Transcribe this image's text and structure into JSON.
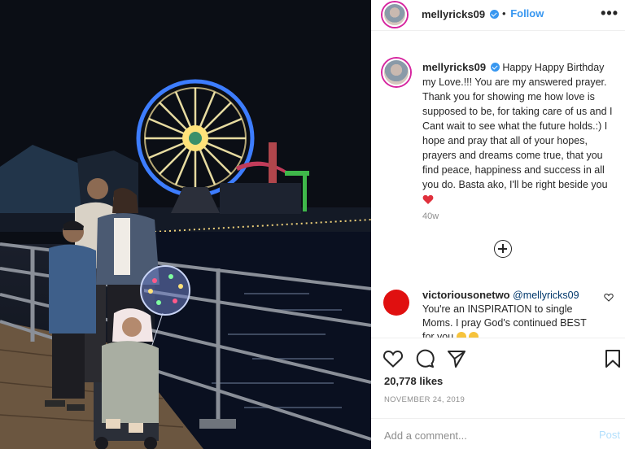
{
  "photo": {
    "alt_icon": "photo-santa-monica-pier-family"
  },
  "header": {
    "username": "mellyricks09",
    "follow_dot": "•",
    "follow_label": "Follow",
    "more_label": "•••"
  },
  "caption": {
    "username": "mellyricks09",
    "text": "Happy Happy Birthday my Love.!!! You are my answered prayer. Thank you for showing me how love is supposed to be, for taking care of us and I Cant wait to see what the future holds.:) I hope and pray that all of your hopes, prayers and dreams come true, that you find peace, happiness and success in all you do. Basta ako, I'll be right beside you",
    "time": "40w"
  },
  "comment": {
    "username": "victoriousonetwo",
    "mention": "@mellyricks09",
    "text": "You're an INSPIRATION to single Moms. I pray God's continued BEST for you"
  },
  "actions": {
    "likes": "20,778 likes",
    "date": "NOVEMBER 24, 2019"
  },
  "add_comment": {
    "placeholder": "Add a comment...",
    "post_label": "Post"
  },
  "colors": {
    "link_blue": "#3897f0",
    "heart_red": "#ed4956",
    "comment_avatar": "#e01010",
    "post_disabled": "#b2dffc"
  }
}
